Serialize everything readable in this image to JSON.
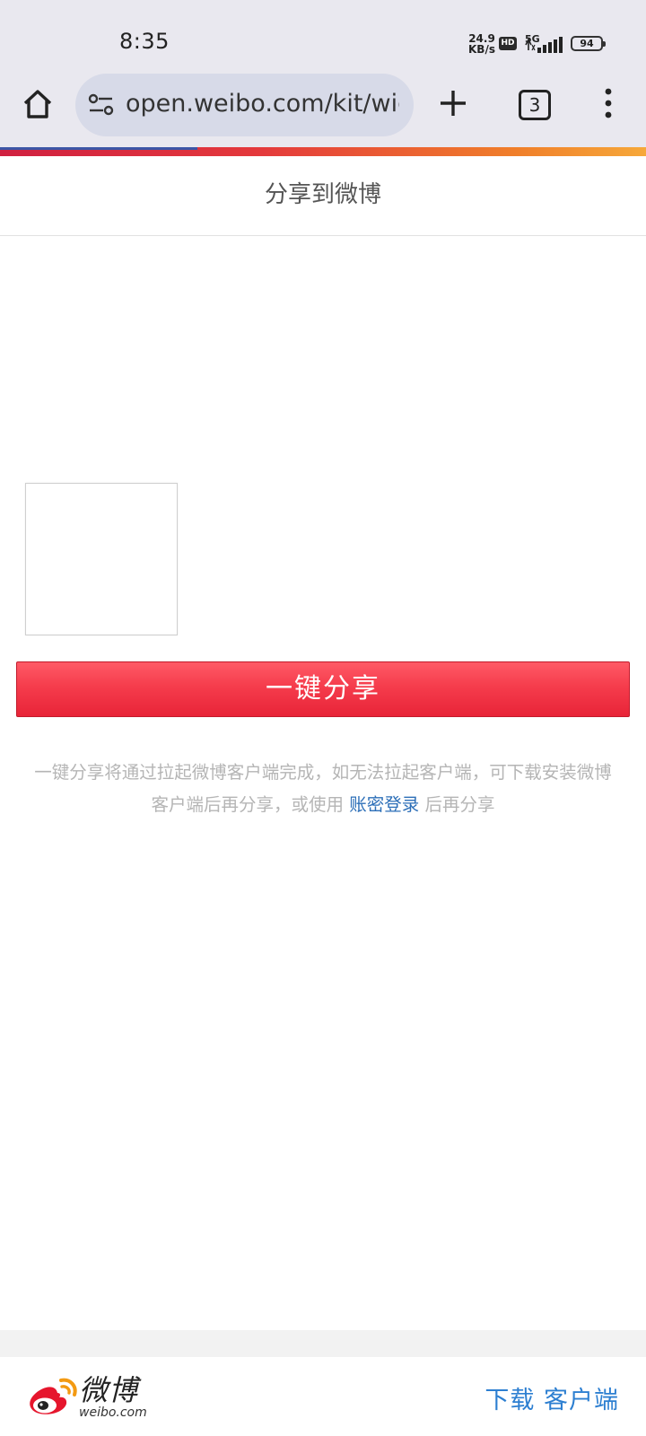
{
  "status_bar": {
    "time": "8:35",
    "net_speed_top": "24.9",
    "net_speed_bottom": "KB/s",
    "hd_badge": "HD",
    "network_type": "5G",
    "battery_level": "94"
  },
  "browser": {
    "url": "open.weibo.com/kit/widget",
    "tab_count": "3",
    "home_icon": "home-icon",
    "site_settings_icon": "tune-icon",
    "new_tab_icon": "plus-icon",
    "menu_icon": "more-vert-icon"
  },
  "page": {
    "title": "分享到微博",
    "share_button_label": "一键分享",
    "hint_text_1": "一键分享将通过拉起微博客户端完成，如无法拉起客户端，可下载安装微博客户端后再分享，或使用",
    "hint_link": "账密登录",
    "hint_text_2": "后再分享"
  },
  "footer": {
    "logo_text": "微博",
    "logo_domain": "weibo.com",
    "download_label": "下载 客户端"
  },
  "colors": {
    "accent_red": "#e82438",
    "link_blue": "#2d6fb8",
    "download_blue": "#2d7fd1"
  }
}
